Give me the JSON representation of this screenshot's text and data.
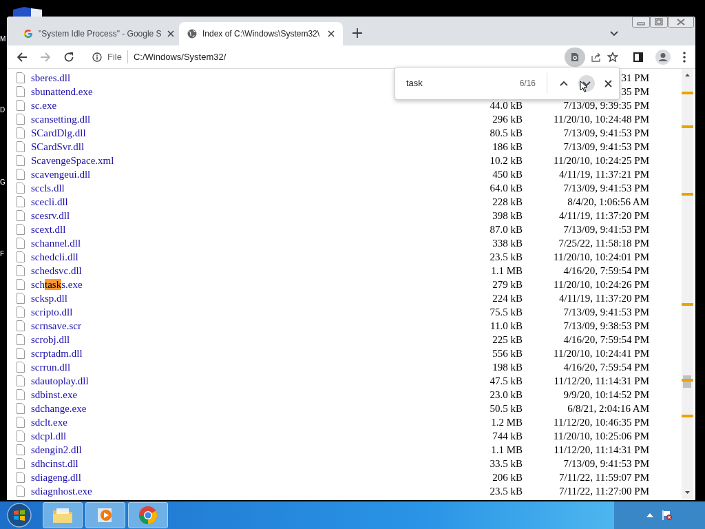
{
  "desktop": {
    "icon_label_fragments": [
      "M",
      "D",
      "G",
      "F"
    ]
  },
  "browser": {
    "tabs": [
      {
        "title": "\"System Idle Process\" - Google S",
        "kind": "google",
        "selected": false
      },
      {
        "title": "Index of C:\\Windows\\System32\\",
        "kind": "globe",
        "selected": true
      }
    ],
    "address_bar": {
      "scheme_label": "File",
      "url": "C:/Windows/System32/"
    },
    "find_bar": {
      "query": "task",
      "count": "6/16"
    },
    "listing": {
      "rows": [
        {
          "name": "sberes.dll",
          "date": "31 PM"
        },
        {
          "name": "sbunattend.exe",
          "date": "35 PM"
        },
        {
          "name": "sc.exe",
          "size": "44.0 kB",
          "date": "7/13/09, 9:39:35 PM"
        },
        {
          "name": "scansetting.dll",
          "size": "296 kB",
          "date": "11/20/10, 10:24:48 PM"
        },
        {
          "name": "SCardDlg.dll",
          "size": "80.5 kB",
          "date": "7/13/09, 9:41:53 PM"
        },
        {
          "name": "SCardSvr.dll",
          "size": "186 kB",
          "date": "7/13/09, 9:41:53 PM"
        },
        {
          "name": "ScavengeSpace.xml",
          "size": "10.2 kB",
          "date": "11/20/10, 10:24:25 PM"
        },
        {
          "name": "scavengeui.dll",
          "size": "450 kB",
          "date": "4/11/19, 11:37:21 PM"
        },
        {
          "name": "sccls.dll",
          "size": "64.0 kB",
          "date": "7/13/09, 9:41:53 PM"
        },
        {
          "name": "scecli.dll",
          "size": "228 kB",
          "date": "8/4/20, 1:06:56 AM"
        },
        {
          "name": "scesrv.dll",
          "size": "398 kB",
          "date": "4/11/19, 11:37:20 PM"
        },
        {
          "name": "scext.dll",
          "size": "87.0 kB",
          "date": "7/13/09, 9:41:53 PM"
        },
        {
          "name": "schannel.dll",
          "size": "338 kB",
          "date": "7/25/22, 11:58:18 PM"
        },
        {
          "name": "schedcli.dll",
          "size": "23.5 kB",
          "date": "11/20/10, 10:24:01 PM"
        },
        {
          "name": "schedsvc.dll",
          "size": "1.1 MB",
          "date": "4/16/20, 7:59:54 PM"
        },
        {
          "name_parts": [
            {
              "text": "sch",
              "highlighted": false
            },
            {
              "text": "task",
              "highlighted": true
            },
            {
              "text": "s.exe",
              "highlighted": false
            }
          ],
          "size": "279 kB",
          "date": "11/20/10, 10:24:26 PM"
        },
        {
          "name": "scksp.dll",
          "size": "224 kB",
          "date": "4/11/19, 11:37:20 PM"
        },
        {
          "name": "scripto.dll",
          "size": "75.5 kB",
          "date": "7/13/09, 9:41:53 PM"
        },
        {
          "name": "scrnsave.scr",
          "size": "11.0 kB",
          "date": "7/13/09, 9:38:53 PM"
        },
        {
          "name": "scrobj.dll",
          "size": "225 kB",
          "date": "4/16/20, 7:59:54 PM"
        },
        {
          "name": "scrptadm.dll",
          "size": "556 kB",
          "date": "11/20/10, 10:24:41 PM"
        },
        {
          "name": "scrrun.dll",
          "size": "198 kB",
          "date": "4/16/20, 7:59:54 PM"
        },
        {
          "name": "sdautoplay.dll",
          "size": "47.5 kB",
          "date": "11/12/20, 11:14:31 PM"
        },
        {
          "name": "sdbinst.exe",
          "size": "23.0 kB",
          "date": "9/9/20, 10:14:52 PM"
        },
        {
          "name": "sdchange.exe",
          "size": "50.5 kB",
          "date": "6/8/21, 2:04:16 AM"
        },
        {
          "name": "sdclt.exe",
          "size": "1.2 MB",
          "date": "11/12/20, 10:46:35 PM"
        },
        {
          "name": "sdcpl.dll",
          "size": "744 kB",
          "date": "11/20/10, 10:25:06 PM"
        },
        {
          "name": "sdengin2.dll",
          "size": "1.1 MB",
          "date": "11/12/20, 11:14:31 PM"
        },
        {
          "name": "sdhcinst.dll",
          "size": "33.5 kB",
          "date": "7/13/09, 9:41:53 PM"
        },
        {
          "name": "sdiageng.dll",
          "size": "206 kB",
          "date": "7/11/22, 11:59:07 PM"
        },
        {
          "name": "sdiagnhost.exe",
          "size": "23.5 kB",
          "date": "7/11/22, 11:27:00 PM"
        }
      ]
    }
  }
}
